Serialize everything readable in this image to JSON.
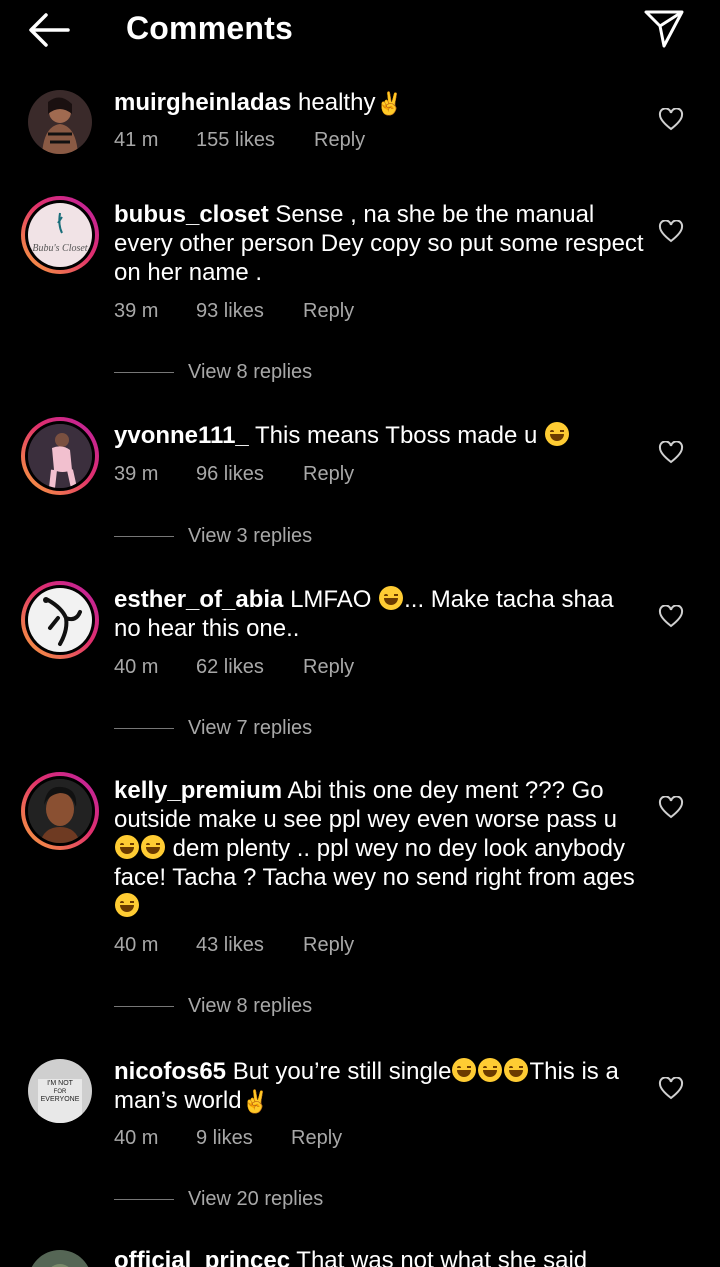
{
  "header": {
    "title": "Comments",
    "back_icon": "arrow-left-icon",
    "send_icon": "paper-plane-icon"
  },
  "comments": [
    {
      "username": "muirgheinladas",
      "text": "healthy",
      "text_emoji": "✌️",
      "time": "41 m",
      "likes": "155 likes",
      "reply": "Reply"
    },
    {
      "username": "bubus_closet",
      "text": "Sense , na she be the manual every other person Dey copy so put some respect on her name .",
      "avatar_text": "Bubu's Closet",
      "time": "39 m",
      "likes": "93 likes",
      "reply": "Reply",
      "view_replies": "View 8 replies"
    },
    {
      "username": "yvonne111_",
      "text": "This means Tboss made u",
      "time": "39 m",
      "likes": "96 likes",
      "reply": "Reply",
      "view_replies": "View 3 replies"
    },
    {
      "username": "esther_of_abia",
      "text_a": "LMFAO",
      "text_b": "... Make tacha shaa no hear this one..",
      "time": "40 m",
      "likes": "62 likes",
      "reply": "Reply",
      "view_replies": "View 7 replies"
    },
    {
      "username": "kelly_premium",
      "text_a": "Abi this one dey ment ??? Go outside make u see ppl wey even worse pass u",
      "text_b": "dem plenty .. ppl wey no dey look anybody face!  Tacha ? Tacha wey no send right from ages",
      "time": "40 m",
      "likes": "43 likes",
      "reply": "Reply",
      "view_replies": "View 8 replies"
    },
    {
      "username": "nicofos65",
      "text_a": "But you’re still single",
      "text_b": "This is a man’s world",
      "avatar_text_1": "I'M NOT",
      "avatar_text_2": "FOR",
      "avatar_text_3": "EVERYONE",
      "time": "40 m",
      "likes": "9 likes",
      "reply": "Reply",
      "view_replies": "View 20 replies"
    },
    {
      "username": "official_princec",
      "text": "That was not what she said"
    }
  ],
  "colors": {
    "background": "#000000",
    "text": "#ffffff",
    "meta": "#a8a8a8",
    "story_ring": "#e1306c"
  }
}
